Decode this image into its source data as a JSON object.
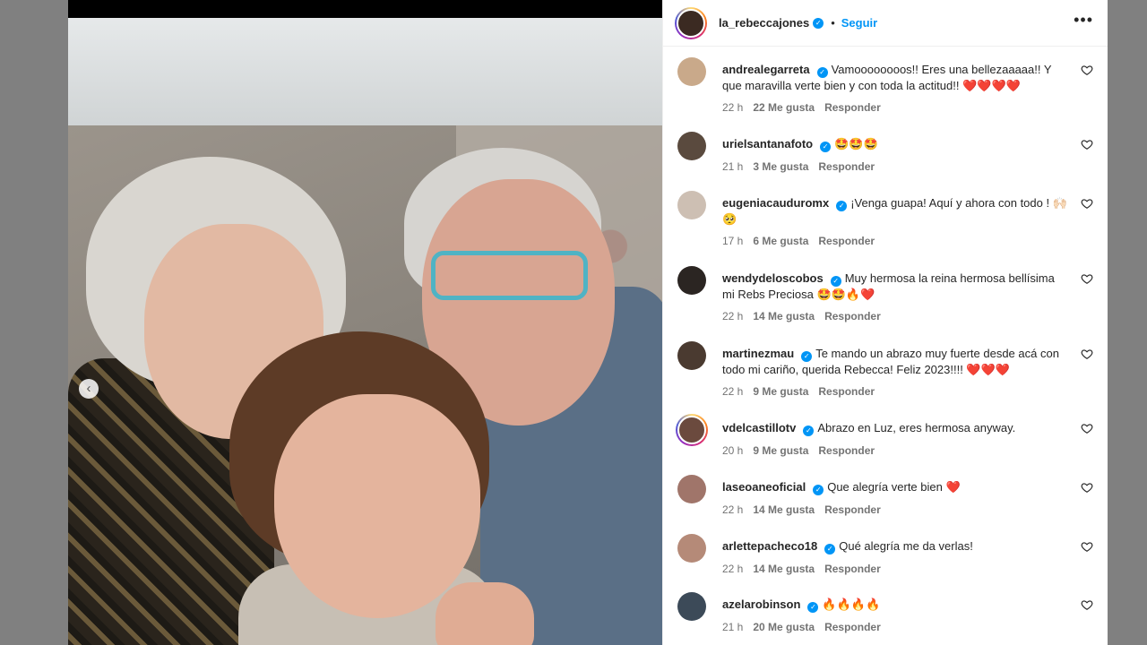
{
  "colors": {
    "accent": "#0095f6",
    "text": "#262626",
    "muted": "#737373",
    "heart": "#ed4956"
  },
  "post": {
    "author": "la_rebeccajones",
    "follow_label": "Seguir",
    "separator": "•",
    "more_label": "•••",
    "prev_label": "‹"
  },
  "comments": [
    {
      "user": "andrealegarreta",
      "text": "Vamoooooooos!! Eres una bellezaaaaa!! Y que maravilla verte bien y con toda la actitud!! ❤️❤️❤️❤️",
      "time": "22 h",
      "likes": "22 Me gusta",
      "reply": "Responder",
      "avatar_color": "#c9a98a"
    },
    {
      "user": "urielsantanafoto",
      "text": "🤩🤩🤩",
      "time": "21 h",
      "likes": "3 Me gusta",
      "reply": "Responder",
      "avatar_color": "#5a4a3e"
    },
    {
      "user": "eugeniacauduromx",
      "text": "¡Venga guapa! Aquí y ahora con todo ! 🙌🏻🥺",
      "time": "17 h",
      "likes": "6 Me gusta",
      "reply": "Responder",
      "avatar_color": "#cdbfb3"
    },
    {
      "user": "wendydeloscobos",
      "text": "Muy hermosa la reina hermosa bellísima mi Rebs Preciosa 🤩🤩🔥❤️",
      "time": "22 h",
      "likes": "14 Me gusta",
      "reply": "Responder",
      "avatar_color": "#2b2522"
    },
    {
      "user": "martinezmau",
      "text": "Te mando un abrazo muy fuerte desde acá con todo mi cariño, querida Rebecca! Feliz 2023!!!! ❤️❤️❤️",
      "time": "22 h",
      "likes": "9 Me gusta",
      "reply": "Responder",
      "avatar_color": "#4a3a30"
    },
    {
      "user": "vdelcastillotv",
      "text": "Abrazo en Luz, eres hermosa anyway.",
      "time": "20 h",
      "likes": "9 Me gusta",
      "reply": "Responder",
      "avatar_color": "#6b4a3e"
    },
    {
      "user": "laseoaneoficial",
      "text": "Que alegría verte bien ❤️",
      "time": "22 h",
      "likes": "14 Me gusta",
      "reply": "Responder",
      "avatar_color": "#a0756a"
    },
    {
      "user": "arlettepacheco18",
      "text": "Qué alegría me da verlas!",
      "time": "22 h",
      "likes": "14 Me gusta",
      "reply": "Responder",
      "avatar_color": "#b58a78"
    },
    {
      "user": "azelarobinson",
      "text": "🔥🔥🔥🔥",
      "time": "21 h",
      "likes": "20 Me gusta",
      "reply": "Responder",
      "avatar_color": "#3c4a58"
    }
  ]
}
